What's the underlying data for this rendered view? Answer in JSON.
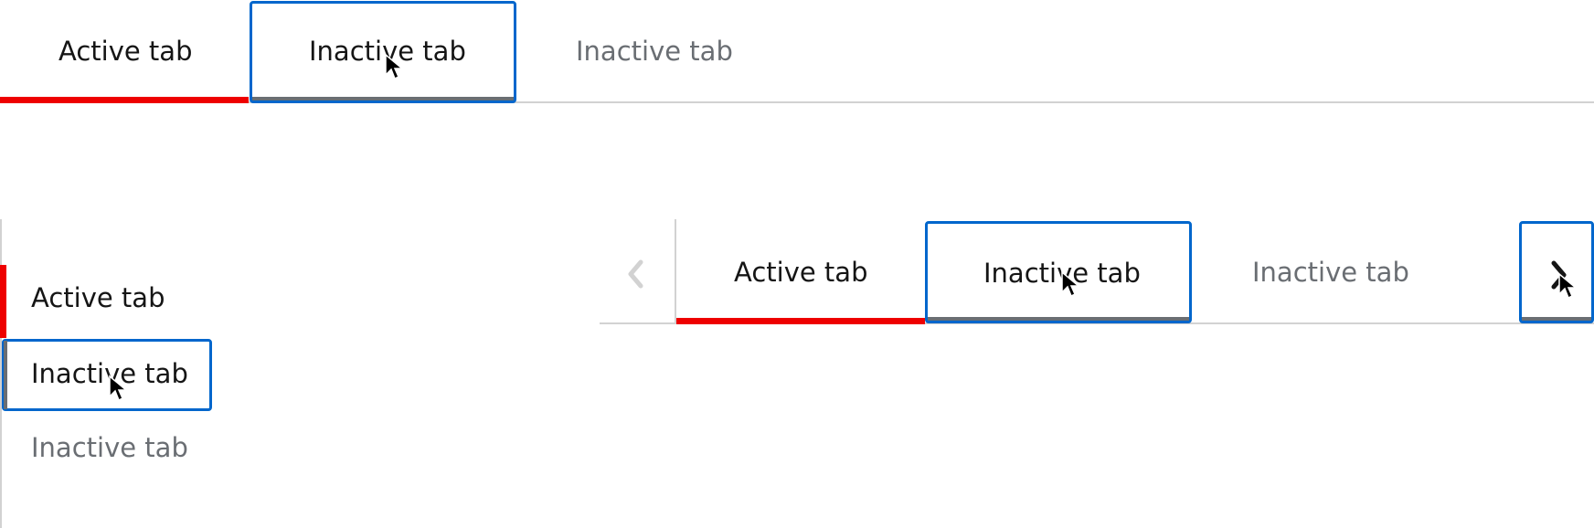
{
  "colors": {
    "active_accent": "#ee0000",
    "focus_ring": "#0066cc",
    "hover_underline": "#6a6e73",
    "divider": "#d2d2d2",
    "text": "#151515",
    "text_muted": "#6a6e73",
    "scroll_button_disabled": "#d2d2d2"
  },
  "horizontal_tabs": {
    "tabs": [
      {
        "label": "Active tab",
        "state": "active"
      },
      {
        "label": "Inactive tab",
        "state": "hover-focus"
      },
      {
        "label": "Inactive tab",
        "state": "inactive"
      }
    ]
  },
  "vertical_tabs": {
    "tabs": [
      {
        "label": "Active tab",
        "state": "active"
      },
      {
        "label": "Inactive tab",
        "state": "hover-focus"
      },
      {
        "label": "Inactive tab",
        "state": "inactive"
      }
    ]
  },
  "scrollable_tabs": {
    "scroll_left_icon": "chevron-left-icon",
    "scroll_left_state": "disabled",
    "scroll_right_icon": "chevron-right-icon",
    "scroll_right_state": "hover-focus",
    "tabs": [
      {
        "label": "Active tab",
        "state": "active"
      },
      {
        "label": "Inactive tab",
        "state": "hover-focus"
      },
      {
        "label": "Inactive tab",
        "state": "inactive"
      }
    ]
  }
}
